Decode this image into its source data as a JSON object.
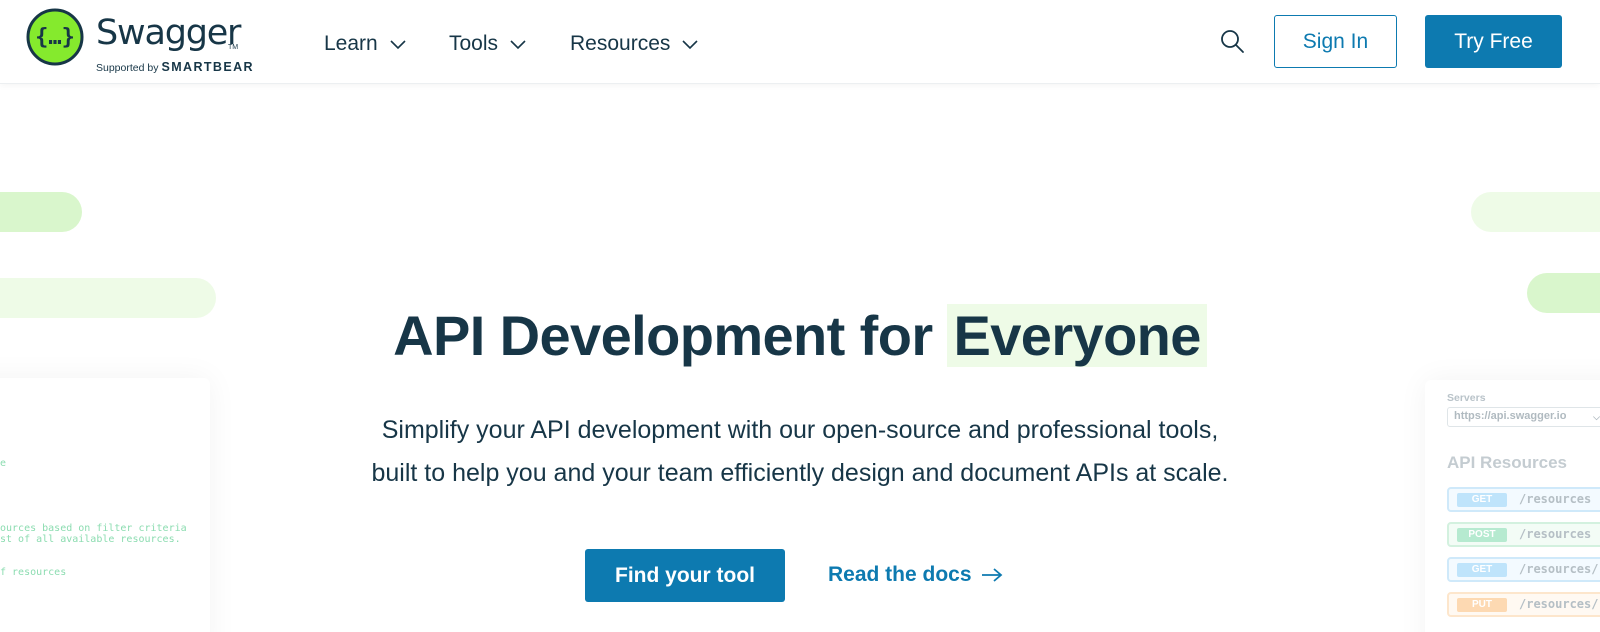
{
  "brand": {
    "name": "Swagger",
    "tm": "TM",
    "supported_by": "Supported by",
    "company": "SMARTBEAR",
    "logo_color": "#85ea2d"
  },
  "nav": {
    "items": [
      {
        "label": "Learn"
      },
      {
        "label": "Tools"
      },
      {
        "label": "Resources"
      }
    ],
    "search_icon": "search-icon",
    "sign_in": "Sign In",
    "try_free": "Try Free"
  },
  "hero": {
    "title_main": "API Development for",
    "title_highlight": "Everyone",
    "subtitle_line1": "Simplify your API development with our open-source and professional tools,",
    "subtitle_line2": "built to help you and your team efficiently design and document APIs at scale.",
    "primary_cta": "Find your tool",
    "secondary_cta": "Read the docs"
  },
  "left_card": {
    "lines": [
      "e",
      "ources based on filter criteria",
      "st of all available resources.",
      "f resources"
    ]
  },
  "right_card": {
    "servers_label": "Servers",
    "server_value": "https://api.swagger.io",
    "resources_title": "API Resources",
    "rows": [
      {
        "method": "GET",
        "path": "/resources"
      },
      {
        "method": "POST",
        "path": "/resources"
      },
      {
        "method": "GET",
        "path": "/resources/"
      },
      {
        "method": "PUT",
        "path": "/resources/"
      }
    ]
  },
  "colors": {
    "primary": "#0d7ab0",
    "text": "#173647",
    "highlight": "#eefbe7"
  }
}
